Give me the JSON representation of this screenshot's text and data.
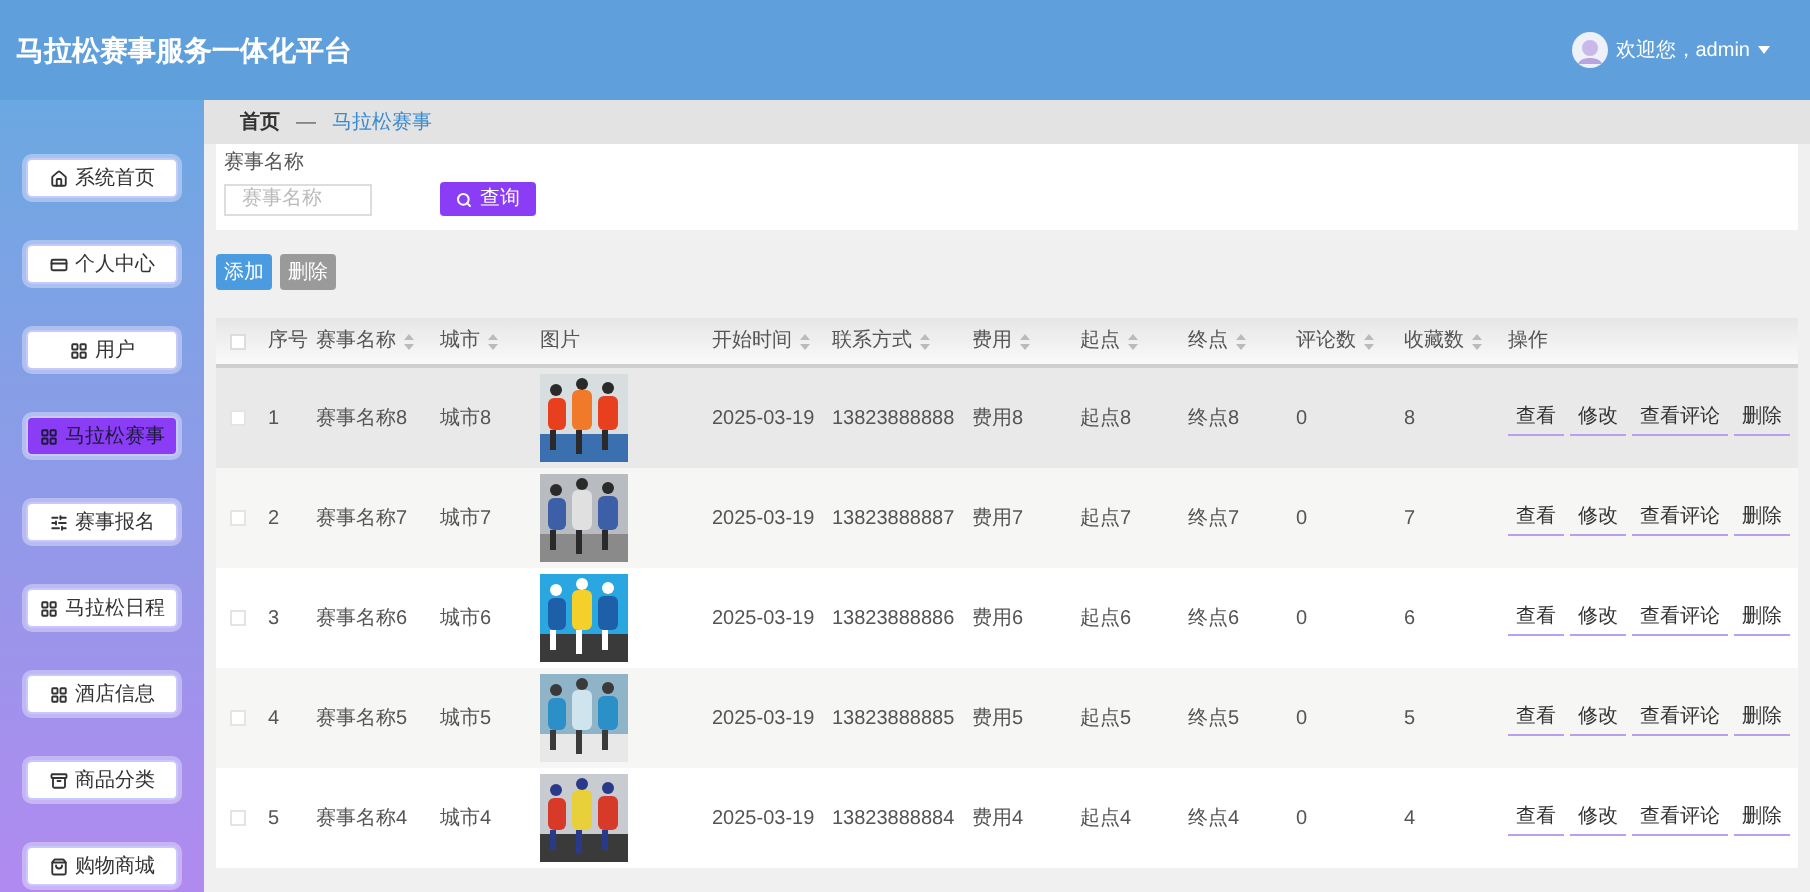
{
  "header": {
    "title": "马拉松赛事服务一体化平台",
    "user": "欢迎您，admin"
  },
  "sidebar": {
    "items": [
      {
        "label": "系统首页",
        "selected": false
      },
      {
        "label": "个人中心",
        "selected": false
      },
      {
        "label": "用户",
        "selected": false
      },
      {
        "label": "马拉松赛事",
        "selected": true
      },
      {
        "label": "赛事报名",
        "selected": false
      },
      {
        "label": "马拉松日程",
        "selected": false
      },
      {
        "label": "酒店信息",
        "selected": false
      },
      {
        "label": "商品分类",
        "selected": false
      },
      {
        "label": "购物商城",
        "selected": false
      }
    ]
  },
  "breadcrumb": [
    "首页",
    "—",
    "马拉松赛事"
  ],
  "search": {
    "label": "赛事名称",
    "placeholder": "赛事名称",
    "button": "查询"
  },
  "actions": [
    {
      "label": "添加",
      "kind": "primary"
    },
    {
      "label": "删除",
      "kind": "muted"
    }
  ],
  "table": {
    "all_checked": false,
    "columns": [
      {
        "label": "序号",
        "sortable": false
      },
      {
        "label": "赛事名称",
        "sortable": true
      },
      {
        "label": "城市",
        "sortable": true
      },
      {
        "label": "图片",
        "sortable": false
      },
      {
        "label": "开始时间",
        "sortable": true
      },
      {
        "label": "联系方式",
        "sortable": true
      },
      {
        "label": "费用",
        "sortable": true
      },
      {
        "label": "起点",
        "sortable": true
      },
      {
        "label": "终点",
        "sortable": true
      },
      {
        "label": "评论数",
        "sortable": true
      },
      {
        "label": "收藏数",
        "sortable": true
      },
      {
        "label": "操作",
        "sortable": false
      }
    ],
    "rows": [
      {
        "checked": false,
        "highlighted": true,
        "cells": [
          "1",
          "赛事名称8",
          "城市8",
          {
            "kind": "picture"
          },
          "2025-03-19",
          "13823888888",
          "费用8",
          "起点8",
          "终点8",
          "0",
          "8",
          [
            "查看",
            "修改",
            "查看评论",
            "删除"
          ]
        ]
      },
      {
        "checked": false,
        "highlighted": false,
        "cells": [
          "2",
          "赛事名称7",
          "城市7",
          {
            "kind": "picture"
          },
          "2025-03-19",
          "13823888887",
          "费用7",
          "起点7",
          "终点7",
          "0",
          "7",
          [
            "查看",
            "修改",
            "查看评论",
            "删除"
          ]
        ]
      },
      {
        "checked": false,
        "highlighted": false,
        "cells": [
          "3",
          "赛事名称6",
          "城市6",
          {
            "kind": "picture"
          },
          "2025-03-19",
          "13823888886",
          "费用6",
          "起点6",
          "终点6",
          "0",
          "6",
          [
            "查看",
            "修改",
            "查看评论",
            "删除"
          ]
        ]
      },
      {
        "checked": false,
        "highlighted": false,
        "cells": [
          "4",
          "赛事名称5",
          "城市5",
          {
            "kind": "picture"
          },
          "2025-03-19",
          "13823888885",
          "费用5",
          "起点5",
          "终点5",
          "0",
          "5",
          [
            "查看",
            "修改",
            "查看评论",
            "删除"
          ]
        ]
      },
      {
        "checked": false,
        "highlighted": false,
        "cells": [
          "5",
          "赛事名称4",
          "城市4",
          {
            "kind": "picture"
          },
          "2025-03-19",
          "13823888884",
          "费用4",
          "起点4",
          "终点4",
          "0",
          "4",
          [
            "查看",
            "修改",
            "查看评论",
            "删除"
          ]
        ]
      }
    ]
  }
}
